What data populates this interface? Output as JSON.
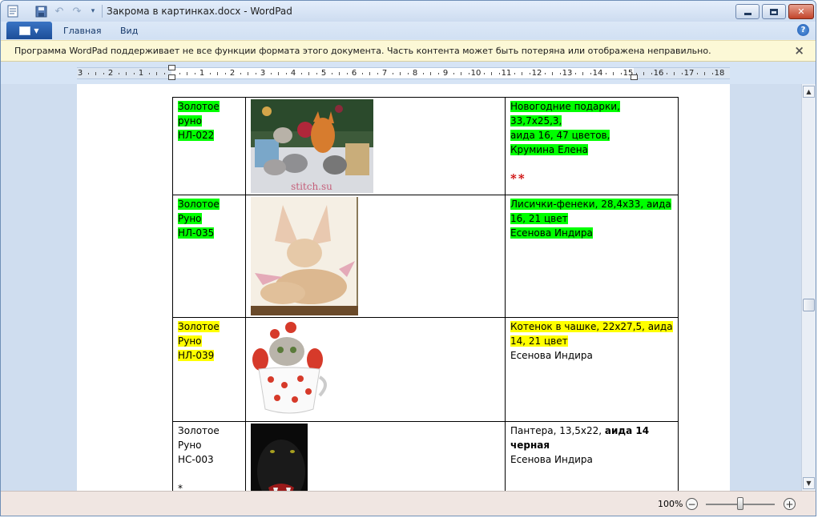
{
  "window": {
    "title": "Закрома в картинках.docx - WordPad",
    "quick_access": [
      "save-icon",
      "undo-icon",
      "redo-icon",
      "customize-icon"
    ]
  },
  "ribbon": {
    "tabs": [
      "Главная",
      "Вид"
    ]
  },
  "infobar": {
    "message": "Программа WordPad поддерживает не все функции формата этого документа. Часть контента может быть потеряна или отображена неправильно.",
    "close": "×"
  },
  "ruler": {
    "labels": [
      "3",
      "2",
      "1",
      "",
      "1",
      "2",
      "3",
      "4",
      "5",
      "6",
      "7",
      "8",
      "9",
      "10",
      "11",
      "12",
      "13",
      "14",
      "15",
      "16",
      "17",
      "18"
    ]
  },
  "table": {
    "rows": [
      {
        "col1": [
          "Золотое",
          "руно",
          "НЛ-022"
        ],
        "col1_highlight": "green",
        "col3": [
          "Новогодние подарки, 33,7х25,3,",
          "аида 16, 47 цветов,",
          "Крумина Елена"
        ],
        "col3_highlight": "green",
        "col3_extra": "**",
        "image": "cats-with-fox"
      },
      {
        "col1": [
          "Золотое",
          "Руно",
          "НЛ-035"
        ],
        "col1_highlight": "green",
        "col3": [
          "Лисички-фенеки, 28,4х33, аида",
          "16, 21 цвет",
          "Есенова Индира"
        ],
        "col3_highlight": "green",
        "image": "fennec-foxes"
      },
      {
        "col1": [
          "Золотое",
          "Руно",
          "НЛ-039"
        ],
        "col1_highlight": "yellow",
        "col3": [
          "Котенок в чашке, 22х27,5, аида",
          "14, 21 цвет"
        ],
        "col3_plain": "Есенова Индира",
        "col3_highlight": "yellow",
        "image": "kitten-in-cup"
      },
      {
        "col1": [
          "Золотое",
          "Руно",
          "НС-003"
        ],
        "col1_extra": "*",
        "col1_highlight": "none",
        "col3_a": "Пантера, 13,5х22, ",
        "col3_bold": "аида 14",
        "col3_bold2": "черная",
        "col3_plain": "Есенова Индира",
        "image": "black-panther"
      }
    ]
  },
  "statusbar": {
    "zoom": "100%",
    "zoom_level_percent": 100
  },
  "colors": {
    "highlight_green": "#00ff00",
    "highlight_yellow": "#ffff00",
    "stars": "#cc0000"
  }
}
